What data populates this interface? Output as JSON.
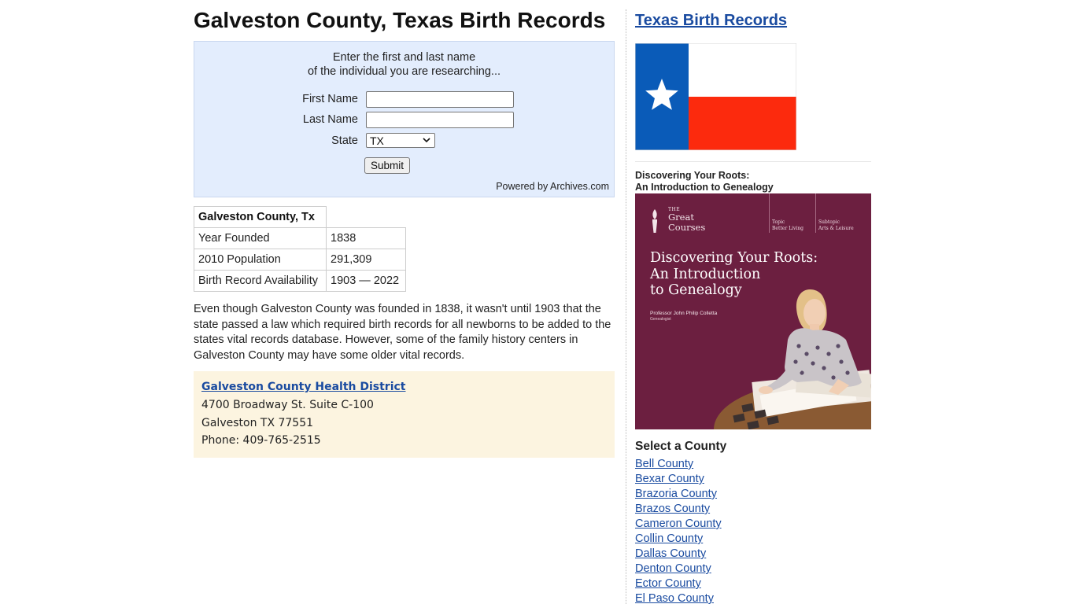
{
  "main": {
    "title": "Galveston County, Texas Birth Records",
    "search": {
      "intro_line1": "Enter the first and last name",
      "intro_line2": "of the individual you are researching...",
      "first_name_label": "First Name",
      "first_name_value": "",
      "last_name_label": "Last Name",
      "last_name_value": "",
      "state_label": "State",
      "state_selected": "TX",
      "submit_label": "Submit",
      "powered_by": "Powered by Archives.com"
    },
    "facts": {
      "header": "Galveston County, Tx",
      "rows": [
        {
          "label": "Year Founded",
          "value": "1838"
        },
        {
          "label": "2010 Population",
          "value": "291,309"
        },
        {
          "label": "Birth Record Availability",
          "value": "1903 — 2022"
        }
      ]
    },
    "paragraph": "Even though Galveston County was founded in 1838, it wasn't until 1903 that the state passed a law which required birth records for all newborns to be added to the states vital records database. However, some of the family history centers in Galveston County may have some older vital records.",
    "office": {
      "name": "Galveston County Health District",
      "address_line1": "4700 Broadway St. Suite C-100",
      "address_line2": "Galveston TX 77551",
      "phone": "Phone: 409-765-2515"
    }
  },
  "sidebar": {
    "title": "Texas Birth Records",
    "flag_colors": {
      "blue": "#0a5bb8",
      "white": "#ffffff",
      "red": "#fc2a0d"
    },
    "book": {
      "caption_line1": "Discovering Your Roots:",
      "caption_line2": "An Introduction to Genealogy",
      "cover_brand_small": "THE",
      "cover_brand_line1": "Great",
      "cover_brand_line2": "Courses",
      "cover_topic_label": "Topic",
      "cover_topic": "Better Living",
      "cover_subtopic_label": "Subtopic",
      "cover_subtopic": "Arts & Leisure",
      "cover_title_line1": "Discovering Your Roots:",
      "cover_title_line2": "An Introduction",
      "cover_title_line3": "to Genealogy",
      "cover_professor": "Professor John Philip Colletta",
      "cover_role": "Genealogist"
    },
    "county_heading": "Select a County",
    "counties": [
      "Bell County",
      "Bexar County",
      "Brazoria County",
      "Brazos County",
      "Cameron County",
      "Collin County",
      "Dallas County",
      "Denton County",
      "Ector County",
      "El Paso County"
    ]
  }
}
